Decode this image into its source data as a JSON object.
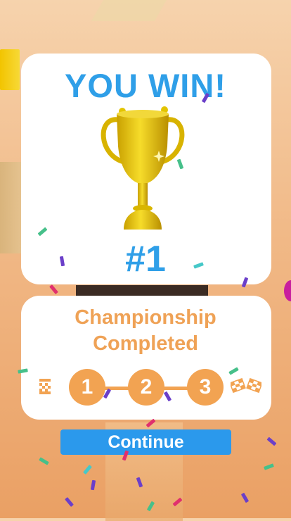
{
  "win_card": {
    "title": "YOU WIN!",
    "rank": "#1",
    "trophy_icon": "trophy-icon"
  },
  "championship": {
    "title_line1": "Championship",
    "title_line2": "Completed",
    "steps": [
      "1",
      "2",
      "3"
    ],
    "start_icon": "start-flag-icon",
    "finish_icon": "checkered-flags-icon"
  },
  "continue_label": "Continue",
  "colors": {
    "accent_blue": "#2f9fe8",
    "accent_orange": "#f2a352",
    "trophy_gold": "#e6c200"
  }
}
